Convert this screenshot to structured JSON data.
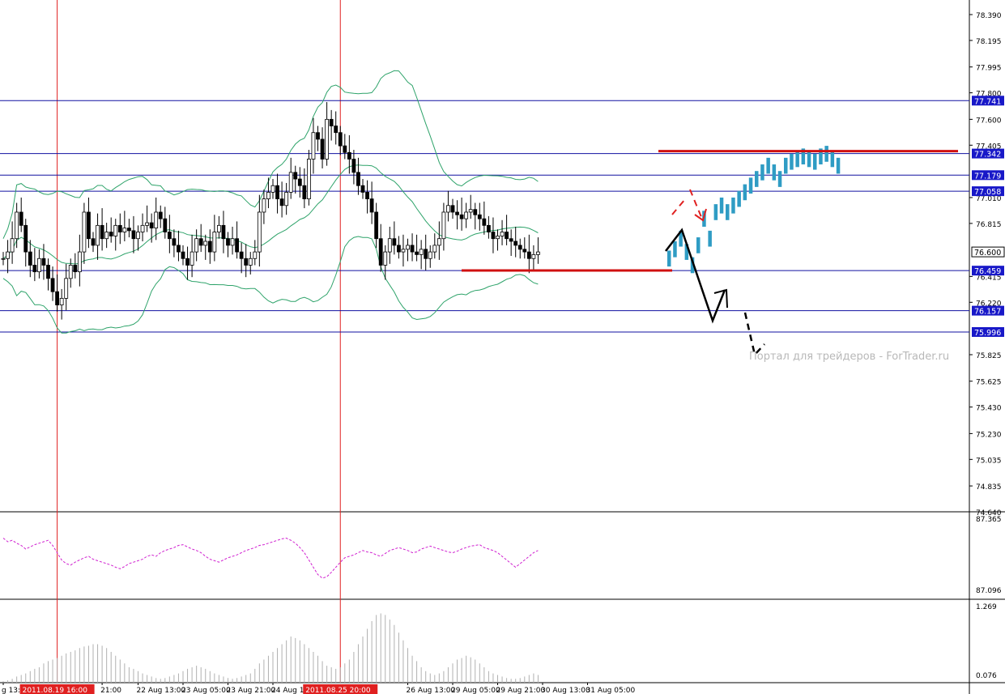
{
  "chart_data": {
    "type": "candlestick",
    "watermark": "Портал для трейдеров - ForTrader.ru",
    "price_scale": {
      "ylim": [
        74.64,
        78.5
      ],
      "ticks": [
        "78.390",
        "78.195",
        "77.995",
        "77.800",
        "77.600",
        "77.405",
        "77.010",
        "76.815",
        "76.415",
        "76.220",
        "75.825",
        "75.625",
        "75.430",
        "75.230",
        "75.035",
        "74.835",
        "74.640"
      ]
    },
    "levels": [
      {
        "value": 77.741,
        "label": "77.741"
      },
      {
        "value": 77.342,
        "label": "77.342"
      },
      {
        "value": 77.179,
        "label": "77.179"
      },
      {
        "value": 77.058,
        "label": "77.058"
      },
      {
        "value": 76.459,
        "label": "76.459"
      },
      {
        "value": 76.157,
        "label": "76.157"
      },
      {
        "value": 75.996,
        "label": "75.996"
      }
    ],
    "current_price": {
      "value": 76.6,
      "label": "76.600"
    },
    "red_levels": [
      {
        "value": 77.36,
        "from_candle": 125,
        "to_candle": 184
      },
      {
        "value": 76.46,
        "from_candle": 89,
        "to_candle": 130
      }
    ],
    "vlines": [
      {
        "candle": 12,
        "label": "2011.08.19 16:00"
      },
      {
        "candle": 75,
        "label": "2011.08.25 20:00"
      }
    ],
    "x_labels": [
      {
        "candle": 0,
        "text": "g 13:00"
      },
      {
        "candle": 12,
        "text": "2011.08.19 16:00"
      },
      {
        "candle": 22,
        "text": "21:00"
      },
      {
        "candle": 30,
        "text": "22 Aug 13:00"
      },
      {
        "candle": 40,
        "text": "23 Aug 05:00"
      },
      {
        "candle": 50,
        "text": "23 Aug 21:00"
      },
      {
        "candle": 60,
        "text": "24 Aug 13:00"
      },
      {
        "candle": 75,
        "text": "2011.08.25 20:00"
      },
      {
        "candle": 90,
        "text": "26 Aug 13:00"
      },
      {
        "candle": 100,
        "text": "29 Aug 05:00"
      },
      {
        "candle": 110,
        "text": "29 Aug 21:00"
      },
      {
        "candle": 120,
        "text": "30 Aug 13:00"
      },
      {
        "candle": 130,
        "text": "31 Aug 05:00"
      }
    ],
    "close": [
      76.55,
      76.6,
      76.7,
      76.9,
      76.8,
      76.6,
      76.5,
      76.45,
      76.55,
      76.5,
      76.4,
      76.3,
      76.2,
      76.25,
      76.4,
      76.5,
      76.45,
      76.6,
      76.9,
      76.7,
      76.65,
      76.8,
      76.7,
      76.75,
      76.72,
      76.8,
      76.75,
      76.78,
      76.76,
      76.7,
      76.75,
      76.8,
      76.82,
      76.78,
      76.9,
      76.85,
      76.75,
      76.7,
      76.65,
      76.6,
      76.55,
      76.5,
      76.6,
      76.7,
      76.65,
      76.68,
      76.6,
      76.75,
      76.8,
      76.7,
      76.65,
      76.7,
      76.6,
      76.55,
      76.5,
      76.55,
      76.6,
      76.9,
      77.0,
      77.05,
      77.1,
      77.0,
      76.95,
      77.05,
      77.2,
      77.15,
      77.1,
      77.0,
      77.3,
      77.5,
      77.45,
      77.3,
      77.6,
      77.55,
      77.5,
      77.4,
      77.35,
      77.3,
      77.2,
      77.1,
      77.05,
      77.0,
      76.9,
      76.7,
      76.5,
      76.6,
      76.7,
      76.65,
      76.6,
      76.62,
      76.65,
      76.6,
      76.58,
      76.62,
      76.55,
      76.6,
      76.65,
      76.7,
      76.9,
      76.95,
      76.9,
      76.88,
      76.85,
      76.9,
      76.92,
      76.88,
      76.85,
      76.8,
      76.75,
      76.7,
      76.72,
      76.75,
      76.7,
      76.68,
      76.65,
      76.62,
      76.6,
      76.55,
      76.58,
      76.6
    ],
    "lower_pane": {
      "label_top": "87.365",
      "label_bottom": "87.096",
      "note": "",
      "values": [
        0.75,
        0.7,
        0.72,
        0.68,
        0.65,
        0.6,
        0.63,
        0.66,
        0.68,
        0.7,
        0.72,
        0.65,
        0.55,
        0.45,
        0.4,
        0.38,
        0.42,
        0.45,
        0.48,
        0.5,
        0.46,
        0.44,
        0.42,
        0.4,
        0.38,
        0.35,
        0.33,
        0.36,
        0.4,
        0.42,
        0.44,
        0.46,
        0.5,
        0.52,
        0.5,
        0.55,
        0.58,
        0.6,
        0.62,
        0.65,
        0.66,
        0.63,
        0.6,
        0.58,
        0.55,
        0.5,
        0.46,
        0.44,
        0.42,
        0.45,
        0.48,
        0.5,
        0.52,
        0.55,
        0.58,
        0.6,
        0.62,
        0.65,
        0.66,
        0.68,
        0.7,
        0.72,
        0.74,
        0.75,
        0.72,
        0.68,
        0.62,
        0.55,
        0.45,
        0.35,
        0.25,
        0.2,
        0.22,
        0.28,
        0.35,
        0.42,
        0.48,
        0.5,
        0.52,
        0.55,
        0.58,
        0.56,
        0.55,
        0.52,
        0.5,
        0.54,
        0.58,
        0.6,
        0.62,
        0.6,
        0.58,
        0.55,
        0.56,
        0.6,
        0.62,
        0.64,
        0.62,
        0.6,
        0.58,
        0.56,
        0.55,
        0.57,
        0.6,
        0.62,
        0.64,
        0.65,
        0.66,
        0.62,
        0.6,
        0.58,
        0.55,
        0.5,
        0.45,
        0.4,
        0.35,
        0.4,
        0.45,
        0.5,
        0.55,
        0.58
      ]
    },
    "histogram": {
      "label_top": "1.269",
      "label_bottom": "0.076",
      "values": [
        0.02,
        0.03,
        0.05,
        0.08,
        0.1,
        0.12,
        0.15,
        0.18,
        0.2,
        0.25,
        0.28,
        0.3,
        0.32,
        0.35,
        0.38,
        0.4,
        0.42,
        0.45,
        0.47,
        0.48,
        0.5,
        0.5,
        0.48,
        0.45,
        0.4,
        0.35,
        0.3,
        0.25,
        0.2,
        0.18,
        0.15,
        0.12,
        0.1,
        0.08,
        0.06,
        0.05,
        0.06,
        0.08,
        0.1,
        0.12,
        0.15,
        0.18,
        0.2,
        0.22,
        0.2,
        0.18,
        0.15,
        0.12,
        0.1,
        0.08,
        0.06,
        0.05,
        0.06,
        0.08,
        0.1,
        0.12,
        0.18,
        0.25,
        0.3,
        0.35,
        0.4,
        0.45,
        0.5,
        0.55,
        0.6,
        0.58,
        0.55,
        0.5,
        0.45,
        0.4,
        0.35,
        0.28,
        0.22,
        0.2,
        0.18,
        0.2,
        0.25,
        0.3,
        0.4,
        0.5,
        0.6,
        0.7,
        0.8,
        0.88,
        0.9,
        0.88,
        0.82,
        0.75,
        0.65,
        0.55,
        0.45,
        0.35,
        0.28,
        0.2,
        0.15,
        0.12,
        0.1,
        0.12,
        0.15,
        0.2,
        0.25,
        0.3,
        0.32,
        0.35,
        0.33,
        0.3,
        0.25,
        0.2,
        0.15,
        0.12,
        0.1,
        0.08,
        0.06,
        0.05,
        0.05,
        0.06,
        0.08,
        0.1,
        0.12,
        0.1
      ]
    },
    "forecast_blocks": {
      "color": "#2f9cc4",
      "closes": [
        76.55,
        76.62,
        76.7,
        76.6,
        76.5,
        76.65,
        76.85,
        76.7,
        76.9,
        76.95,
        76.9,
        76.95,
        77.0,
        77.05,
        77.1,
        77.15,
        77.2,
        77.25,
        77.2,
        77.15,
        77.25,
        77.28,
        77.3,
        77.32,
        77.3,
        77.28,
        77.32,
        77.34,
        77.3,
        77.25
      ]
    }
  }
}
